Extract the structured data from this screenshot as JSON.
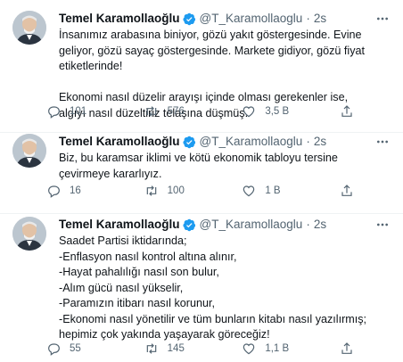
{
  "tweets": [
    {
      "name": "Temel Karamollaoğlu",
      "handle": "@T_Karamollaoglu",
      "dot": "·",
      "time": "2s",
      "text": "İnsanımız arabasına biniyor, gözü yakıt göstergesinde. Evine geliyor, gözü sayaç göstergesinde. Markete gidiyor, gözü fiyat etiketlerinde!\n\nEkonomi nasıl düzelir arayışı içinde olması gerekenler ise, algıyı nasıl düzeltiriz telaşına düşmüş.",
      "replies": "101",
      "retweets": "576",
      "likes": "3,5 B"
    },
    {
      "name": "Temel Karamollaoğlu",
      "handle": "@T_Karamollaoglu",
      "dot": "·",
      "time": "2s",
      "text": "Biz, bu karamsar iklimi ve kötü ekonomik tabloyu tersine çevirmeye kararlıyız.",
      "replies": "16",
      "retweets": "100",
      "likes": "1 B"
    },
    {
      "name": "Temel Karamollaoğlu",
      "handle": "@T_Karamollaoglu",
      "dot": "·",
      "time": "2s",
      "text": "Saadet Partisi iktidarında;\n-Enflasyon nasıl kontrol altına alınır,\n-Hayat pahalılığı nasıl son bulur,\n-Alım gücü nasıl yükselir,\n-Paramızın itibarı nasıl korunur,\n-Ekonomi nasıl yönetilir ve tüm bunların kitabı nasıl yazılırmış; hepimiz çok yakında yaşayarak göreceğiz!",
      "replies": "55",
      "retweets": "145",
      "likes": "1,1 B"
    }
  ],
  "colors": {
    "accent": "#1d9bf0",
    "muted": "#536471",
    "text": "#0f1419",
    "divider": "#eff3f4"
  },
  "icons": [
    "avatar",
    "verified-badge-icon",
    "more-icon",
    "reply-icon",
    "retweet-icon",
    "like-icon",
    "share-icon"
  ]
}
